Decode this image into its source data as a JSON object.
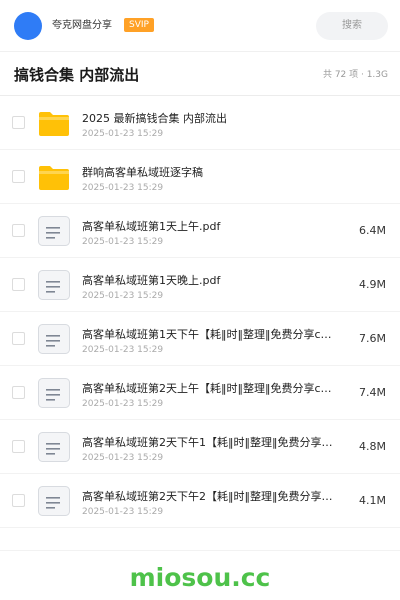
{
  "header": {
    "username": "夸克网盘分享",
    "vip_badge": "SVIP",
    "search_placeholder": "搜索"
  },
  "folder": {
    "title": "搞钱合集 内部流出",
    "meta": "共 72 项 · 1.3G"
  },
  "files": [
    {
      "name": "2025 最新搞钱合集 内部流出",
      "date": "2025-01-23 15:29",
      "size": "",
      "icon": "folder-icon"
    },
    {
      "name": "群响高客单私域班逐字稿",
      "date": "2025-01-23 15:29",
      "size": "",
      "icon": "folder-icon"
    },
    {
      "name": "高客单私域班第1天上午.pdf",
      "date": "2025-01-23 15:29",
      "size": "6.4M",
      "icon": "document-icon"
    },
    {
      "name": "高客单私域班第1天晚上.pdf",
      "date": "2025-01-23 15:29",
      "size": "4.9M",
      "icon": "document-icon"
    },
    {
      "name": "高客单私域班第1天下午【耗‖时‖整理‖免费分享c…",
      "date": "2025-01-23 15:29",
      "size": "7.6M",
      "icon": "document-icon"
    },
    {
      "name": "高客单私域班第2天上午【耗‖时‖整理‖免费分享c…",
      "date": "2025-01-23 15:29",
      "size": "7.4M",
      "icon": "document-icon"
    },
    {
      "name": "高客单私域班第2天下午1【耗‖时‖整理‖免费分享…",
      "date": "2025-01-23 15:29",
      "size": "4.8M",
      "icon": "document-icon"
    },
    {
      "name": "高客单私域班第2天下午2【耗‖时‖整理‖免费分享…",
      "date": "2025-01-23 15:29",
      "size": "4.1M",
      "icon": "document-icon"
    }
  ],
  "watermark": "miosou.cc",
  "colors": {
    "avatar": "#2f7cf6",
    "vip": "#ffa126",
    "folder": "#ffc107",
    "watermark": "#4ec24a"
  }
}
